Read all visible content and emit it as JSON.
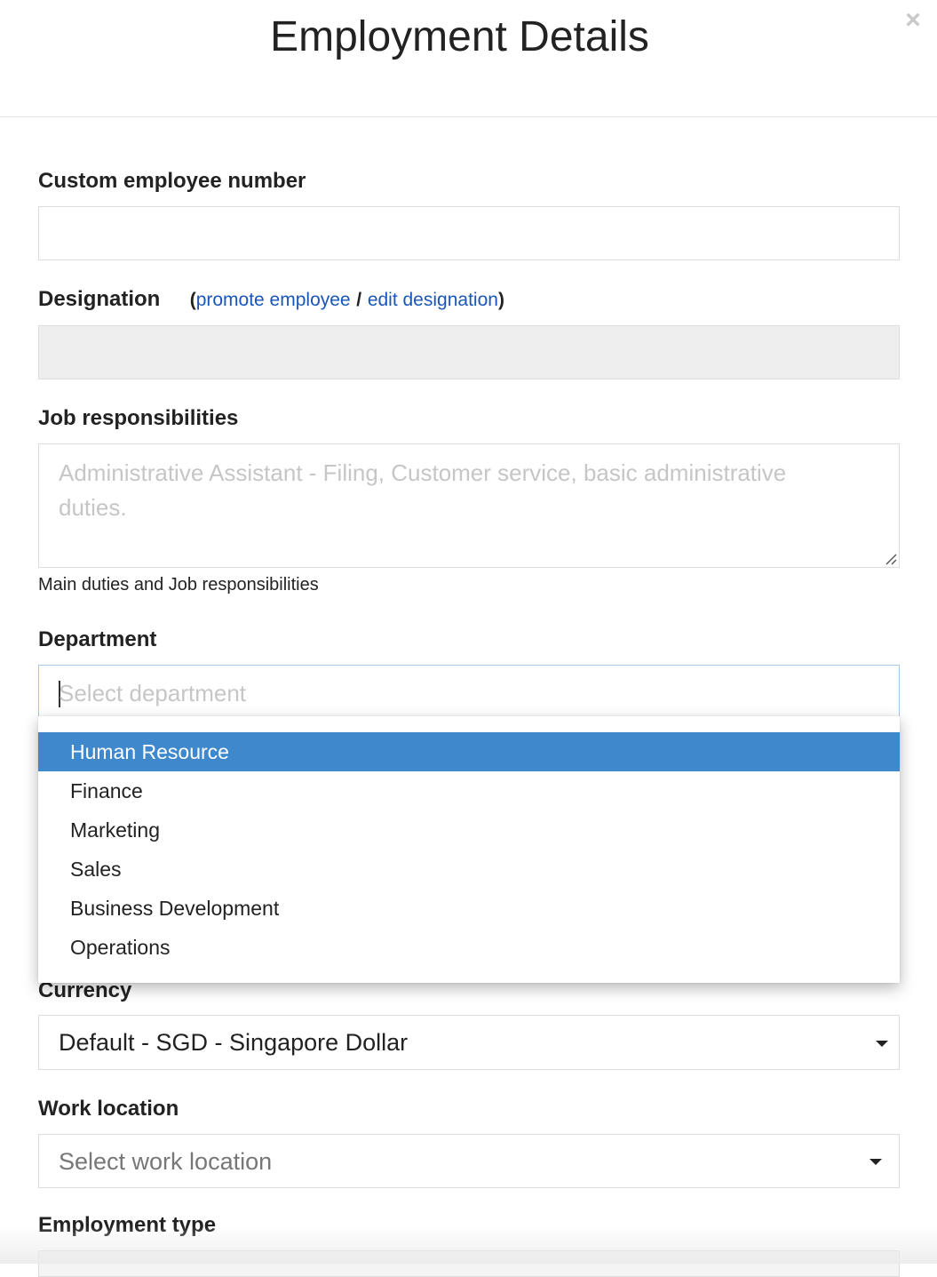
{
  "modal": {
    "title": "Employment Details",
    "close_symbol": "×"
  },
  "fields": {
    "custom_employee_number": {
      "label": "Custom employee number",
      "value": ""
    },
    "designation": {
      "label": "Designation",
      "open_paren": "(",
      "promote_link": "promote employee",
      "separator": "/",
      "edit_link": "edit designation",
      "close_paren": ")",
      "value": ""
    },
    "job_responsibilities": {
      "label": "Job responsibilities",
      "placeholder": "Administrative Assistant - Filing, Customer service, basic administrative duties.",
      "help": "Main duties and Job responsibilities"
    },
    "department": {
      "label": "Department",
      "placeholder": "Select department",
      "options": [
        "Human Resource",
        "Finance",
        "Marketing",
        "Sales",
        "Business Development",
        "Operations"
      ],
      "highlighted_option": "Human Resource"
    },
    "currency": {
      "label": "Currency",
      "value": "Default - SGD - Singapore Dollar"
    },
    "work_location": {
      "label": "Work location",
      "placeholder": "Select work location"
    },
    "employment_type": {
      "label": "Employment type"
    }
  },
  "icons": {
    "close": "close-icon",
    "dropdown_arrow": "caret-down-icon",
    "resize": "resize-handle-icon"
  },
  "colors": {
    "link": "#1a56b8",
    "highlight": "#3f88cb",
    "disabled_field": "#eeeeee"
  }
}
